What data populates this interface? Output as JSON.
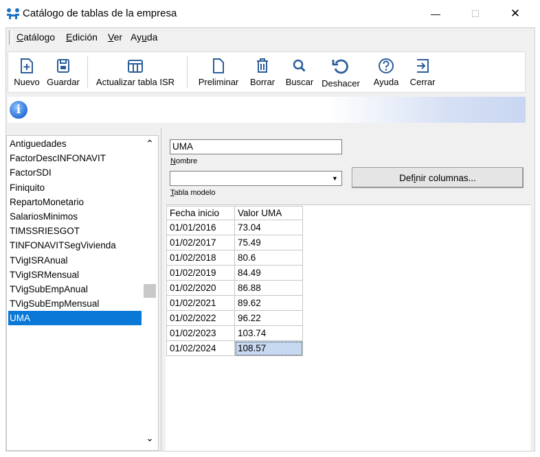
{
  "window": {
    "title": "Catálogo de tablas de la empresa",
    "minimize_glyph": "—",
    "maximize_glyph": "☐",
    "close_glyph": "✕"
  },
  "menu": [
    "Catálogo",
    "Edición",
    "Ver",
    "Ayuda"
  ],
  "toolbar": {
    "nuevo": "Nuevo",
    "guardar": "Guardar",
    "actualizar": "Actualizar tabla ISR",
    "preliminar": "Preliminar",
    "borrar": "Borrar",
    "buscar": "Buscar",
    "deshacer": "Deshacer",
    "ayuda": "Ayuda",
    "cerrar": "Cerrar"
  },
  "info_glyph": "i",
  "tables_list": {
    "items": [
      "Antiguedades",
      "FactorDescINFONAVIT",
      "FactorSDI",
      "Finiquito",
      "RepartoMonetario",
      "SalariosMinimos",
      "TIMSSRIESGOT",
      "TINFONAVITSegVivienda",
      "TVigISRAnual",
      "TVigISRMensual",
      "TVigSubEmpAnual",
      "TVigSubEmpMensual",
      "UMA"
    ],
    "selected": "UMA",
    "scroll_up": "⌃",
    "scroll_down": "⌄"
  },
  "form": {
    "nombre_value": "UMA",
    "nombre_label": "Nombre",
    "tabla_modelo_value": "",
    "tabla_modelo_label": "Tabla modelo",
    "definir_button": "Definir columnas..."
  },
  "grid": {
    "columns": [
      "Fecha  inicio",
      "Valor  UMA"
    ],
    "rows": [
      [
        "01/01/2016",
        "73.04"
      ],
      [
        "01/02/2017",
        "75.49"
      ],
      [
        "01/02/2018",
        "80.6"
      ],
      [
        "01/02/2019",
        "84.49"
      ],
      [
        "01/02/2020",
        "86.88"
      ],
      [
        "01/02/2021",
        "89.62"
      ],
      [
        "01/02/2022",
        "96.22"
      ],
      [
        "01/02/2023",
        "103.74"
      ],
      [
        "01/02/2024",
        "108.57"
      ]
    ]
  },
  "colors": {
    "selection": "#0a78d7",
    "cell_selection": "#c7d9f1",
    "app_icon": "#1a73c9"
  }
}
